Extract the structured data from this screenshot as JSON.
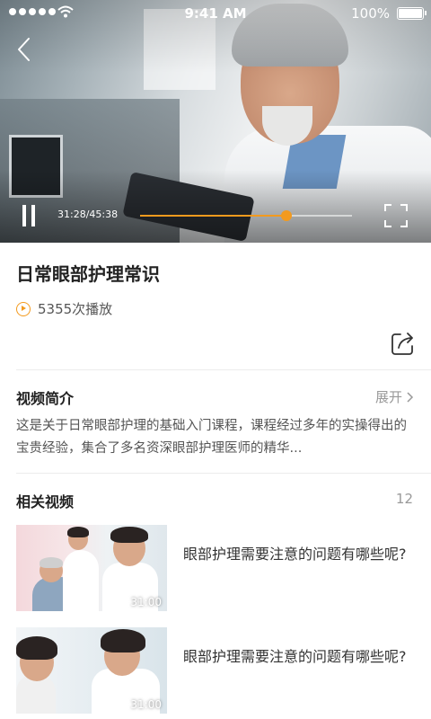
{
  "status_bar": {
    "time": "9:41 AM",
    "battery": "100%"
  },
  "player": {
    "time": "31:28/45:38",
    "progress": 0.69,
    "accent_color": "#f39a1e"
  },
  "video": {
    "title": "日常眼部护理常识",
    "plays": "5355次播放"
  },
  "intro": {
    "heading": "视频简介",
    "expand_label": "展开",
    "text": "这是关于日常眼部护理的基础入门课程，课程经过多年的实操得出的宝贵经验，集合了多名资深眼部护理医师的精华..."
  },
  "related": {
    "heading": "相关视频",
    "count": "12",
    "items": [
      {
        "title": "眼部护理需要注意的问题有哪些呢?",
        "duration": "31:00"
      },
      {
        "title": "眼部护理需要注意的问题有哪些呢?",
        "duration": "31:00"
      }
    ]
  },
  "icons": {
    "back": "chevron-left-icon",
    "pause": "pause-icon",
    "fullscreen": "fullscreen-icon",
    "share": "share-icon",
    "play_count": "play-circle-icon",
    "expand": "chevron-right-icon"
  }
}
